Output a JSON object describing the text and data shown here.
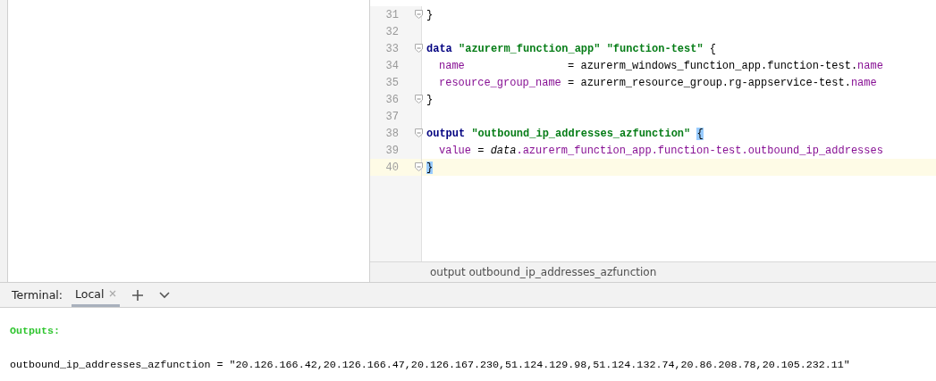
{
  "editor": {
    "lines": [
      {
        "number": "31",
        "fold": true,
        "current": false,
        "indented": false,
        "tokens": [
          {
            "kind": "plain",
            "text": "}"
          }
        ]
      },
      {
        "number": "32",
        "fold": false,
        "current": false
      },
      {
        "number": "33",
        "fold": true,
        "current": false,
        "indented": false,
        "tokens": [
          {
            "kind": "keyword",
            "text": "data"
          },
          {
            "kind": "string",
            "text": " \"azurerm_function_app\""
          },
          {
            "kind": "string",
            "text": " \"function-test\""
          },
          {
            "kind": "plain",
            "text": " {"
          }
        ]
      },
      {
        "number": "34",
        "fold": false,
        "current": false,
        "indented": true,
        "tokens": [
          {
            "kind": "prop",
            "text": "name"
          },
          {
            "kind": "plain",
            "text": "                = azurerm_windows_function_app.function-test."
          },
          {
            "kind": "prop",
            "text": "name"
          }
        ]
      },
      {
        "number": "35",
        "fold": false,
        "current": false,
        "indented": true,
        "tokens": [
          {
            "kind": "prop",
            "text": "resource_group_name"
          },
          {
            "kind": "plain",
            "text": " = azurerm_resource_group.rg-appservice-test."
          },
          {
            "kind": "prop",
            "text": "name"
          }
        ]
      },
      {
        "number": "36",
        "fold": true,
        "current": false,
        "indented": false,
        "tokens": [
          {
            "kind": "plain",
            "text": "}"
          }
        ]
      },
      {
        "number": "37",
        "fold": false,
        "current": false
      },
      {
        "number": "38",
        "fold": true,
        "current": false,
        "indented": false,
        "tokens": [
          {
            "kind": "keyword",
            "text": "output"
          },
          {
            "kind": "string",
            "text": " \"outbound_ip_addresses_azfunction\" "
          },
          {
            "kind": "match",
            "text": "{"
          }
        ]
      },
      {
        "number": "39",
        "fold": false,
        "current": false,
        "indented": true,
        "tokens": [
          {
            "kind": "prop",
            "text": "value"
          },
          {
            "kind": "plain",
            "text": " = "
          },
          {
            "kind": "italic",
            "text": "data"
          },
          {
            "kind": "prop",
            "text": ".azurerm_function_app.function-test.outbound_ip_addresses"
          }
        ]
      },
      {
        "number": "40",
        "fold": true,
        "current": true,
        "indented": false,
        "tokens": [
          {
            "kind": "match",
            "text": "}"
          }
        ]
      }
    ]
  },
  "breadcrumb": "output outbound_ip_addresses_azfunction",
  "terminal": {
    "label": "Terminal:",
    "tabs": [
      {
        "label": "Local",
        "selected": true
      }
    ],
    "lines": [
      {
        "kind": "heading",
        "text": "Outputs:"
      },
      {
        "kind": "plain",
        "text": "outbound_ip_addresses_azfunction = \"20.126.166.42,20.126.166.47,20.126.167.230,51.124.129.98,51.124.132.74,20.86.208.78,20.105.232.11\""
      }
    ]
  }
}
